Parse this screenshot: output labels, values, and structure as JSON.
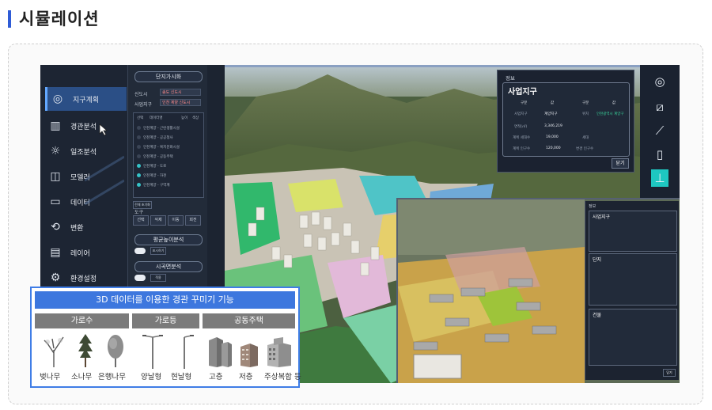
{
  "page": {
    "title": "시뮬레이션"
  },
  "nav": {
    "items": [
      {
        "label": "지구계획"
      },
      {
        "label": "경관분석"
      },
      {
        "label": "일조분석"
      },
      {
        "label": "모델러"
      },
      {
        "label": "데이터"
      },
      {
        "label": "변환"
      },
      {
        "label": "레이어"
      },
      {
        "label": "환경설정"
      }
    ]
  },
  "panel": {
    "header": "단지가시화",
    "field1_label": "신도시",
    "field1_value": "송도 신도시",
    "field2_label": "사업지구",
    "field2_value": "인천 계양 신도시",
    "table_headers": [
      "선택",
      "데이터명",
      "높이",
      "색상"
    ],
    "rows": [
      "인천계양 - 근린생활시설",
      "인천계양 - 공공청사",
      "인천계양 - 복지문화시설",
      "인천계양 - 공동주택",
      "인천계양 - 도로",
      "인천계양 - 하천",
      "인천계양 - 구역계"
    ],
    "reset_label": "전체 초기화",
    "tools_label": "도구",
    "tools": [
      "선택",
      "삭제",
      "이동",
      "회전"
    ],
    "avg_height_btn": "평균높이분석",
    "avg_small": "표시하기",
    "view_btn": "시곡면분석",
    "view_small": "적용"
  },
  "info_popup": {
    "heading": "정보",
    "title": "사업지구",
    "col_headers": [
      "구분",
      "값",
      "구분",
      "값"
    ],
    "rows": [
      [
        "사업지구",
        "계양지구",
        "위치",
        "인천광역시 계양구"
      ],
      [
        "면적(㎡)",
        "3,346,219",
        "",
        ""
      ],
      [
        "계획 세대수",
        "19,000",
        "세대",
        ""
      ],
      [
        "계획 인구수",
        "120,000",
        "변경 인구수",
        ""
      ]
    ],
    "close_label": "닫기"
  },
  "inset_panel": {
    "heading": "정보",
    "section1": "사업지구",
    "section2": "단지",
    "section3": "건물",
    "close_label": "닫기"
  },
  "legend_card": {
    "title": "3D 데이터를 이용한 경관 꾸미기 기능",
    "categories": [
      "가로수",
      "가로등",
      "공동주택"
    ],
    "items": [
      "벚나무",
      "소나무",
      "은행나무",
      "양날형",
      "현날형",
      "고층",
      "저층",
      "주상복합 등"
    ]
  },
  "colors": {
    "accent": "#3d77de",
    "teal": "#1ec7c1",
    "nav_bg": "#1d2533"
  }
}
